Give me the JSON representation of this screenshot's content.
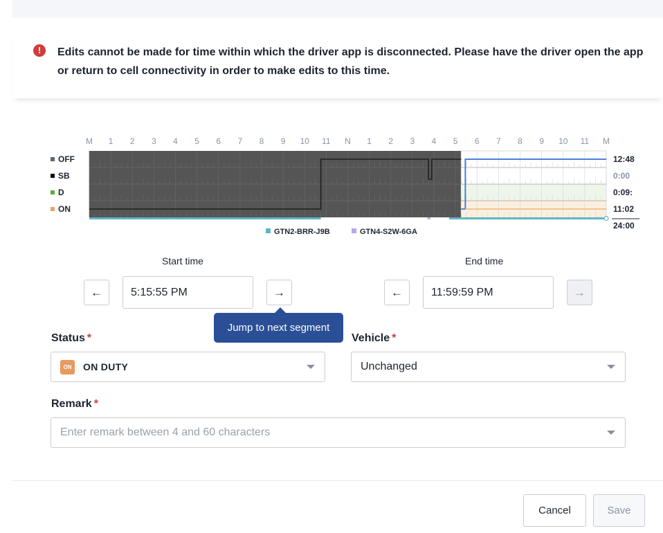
{
  "alert": {
    "icon": "exclamation-circle-icon",
    "color": "#d13c3c",
    "message": "Edits cannot be made for time within which the driver app is disconnected. Please have the driver open the app or return to cell connectivity in order to make edits to this time."
  },
  "log_chart": {
    "hour_labels": [
      "M",
      "1",
      "2",
      "3",
      "4",
      "5",
      "6",
      "7",
      "8",
      "9",
      "10",
      "11",
      "N",
      "1",
      "2",
      "3",
      "4",
      "5",
      "6",
      "7",
      "8",
      "9",
      "10",
      "11",
      "M"
    ],
    "statuses": [
      {
        "code": "OFF",
        "color": "#5f6670",
        "total": "12:48"
      },
      {
        "code": "SB",
        "color": "#111111",
        "total": "0:00"
      },
      {
        "code": "D",
        "color": "#5fae3c",
        "total": "0:09:"
      },
      {
        "code": "ON",
        "color": "#e8a468",
        "total": "11:02"
      }
    ],
    "grand_total": "24:00",
    "legend": [
      {
        "label": "GTN2-BRR-J9B",
        "color": "#5fb6c4"
      },
      {
        "label": "GTN4-S2W-6GA",
        "color": "#b9a6f0"
      }
    ],
    "disconnected_color": "#555555",
    "selection_color": "#4a7fe0"
  },
  "start_time": {
    "label": "Start time",
    "value": "5:15:55 PM",
    "prev_icon": "arrow-left-icon",
    "next_icon": "arrow-right-icon"
  },
  "end_time": {
    "label": "End time",
    "value": "11:59:59 PM",
    "prev_icon": "arrow-left-icon",
    "next_icon": "arrow-right-icon"
  },
  "tooltip": "Jump to next segment",
  "status": {
    "label": "Status",
    "required": "*",
    "badge": "ON",
    "value": "ON DUTY"
  },
  "vehicle": {
    "label": "Vehicle",
    "required": "*",
    "value": "Unchanged"
  },
  "remark": {
    "label": "Remark",
    "required": "*",
    "placeholder": "Enter remark between 4 and 60 characters"
  },
  "footer": {
    "cancel": "Cancel",
    "save": "Save"
  },
  "arrows": {
    "left": "←",
    "right": "→"
  }
}
